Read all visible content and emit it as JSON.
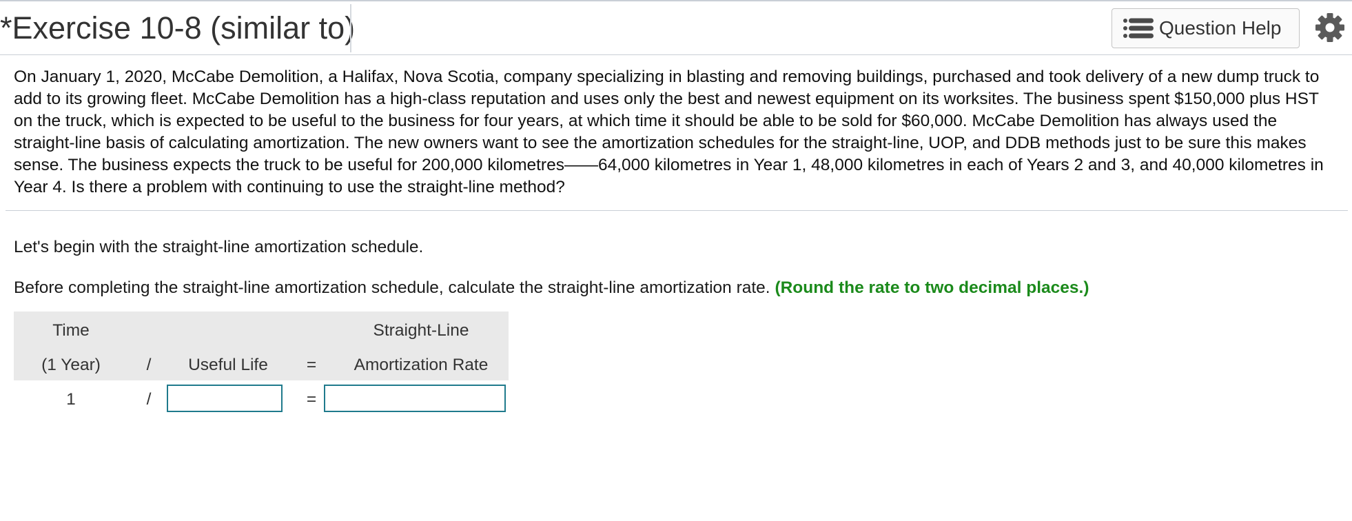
{
  "header": {
    "title": "*Exercise 10-8 (similar to)",
    "help_button_label": "Question Help",
    "help_icon": "list-icon",
    "settings_icon": "gear-icon"
  },
  "problem": {
    "text": "On January 1, 2020, McCabe Demolition, a Halifax, Nova Scotia, company specializing in blasting and removing buildings, purchased and took delivery of a new dump truck to add to its growing fleet. McCabe Demolition has a high-class reputation and uses only the best and newest equipment on its worksites. The business spent $150,000 plus HST on the truck, which is expected to be useful to the business for four years, at which time it should be able to be sold for $60,000. McCabe Demolition has always used the straight-line basis of calculating amortization. The new owners want to see the amortization schedules for the straight-line, UOP, and DDB methods just to be sure this makes sense. The business expects the truck to be useful for 200,000 kilometres——64,000 kilometres in Year 1, 48,000 kilometres in each of Years 2 and 3, and 40,000 kilometres in Year 4. Is there a problem with continuing to use the straight-line method?"
  },
  "body": {
    "intro": "Let's begin with the straight-line amortization schedule.",
    "instruction": "Before completing the straight-line amortization schedule, calculate the straight-line amortization rate.",
    "hint": "(Round the rate to two decimal places.)"
  },
  "calc": {
    "col1_line1": "Time",
    "col1_line2": "(1 Year)",
    "op1": "/",
    "col2_line2": "Useful Life",
    "op2": "=",
    "col3_line1": "Straight-Line",
    "col3_line2": "Amortization Rate",
    "row_time": "1",
    "row_op1": "/",
    "row_op2": "=",
    "useful_life_value": "",
    "rate_value": ""
  }
}
